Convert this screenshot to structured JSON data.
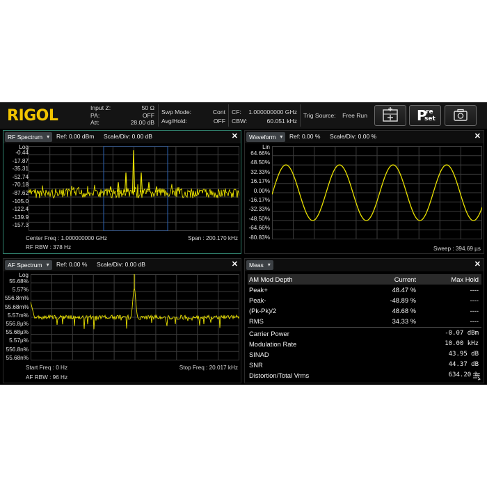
{
  "brand": "RIGOL",
  "header": {
    "input_z_label": "Input Z:",
    "input_z_value": "50 Ω",
    "pa_label": "PA:",
    "pa_value": "OFF",
    "att_label": "Att:",
    "att_value": "28.00 dB",
    "swp_mode_label": "Swp Mode:",
    "swp_mode_value": "Cont",
    "avg_hold_label": "Avg/Hold:",
    "avg_hold_value": "OFF",
    "cf_label": "CF:",
    "cf_value": "1.000000000 GHz",
    "cbw_label": "CBW:",
    "cbw_value": "60.051 kHz",
    "trig_label": "Trig Source:",
    "trig_value": "Free Run",
    "buttons": [
      {
        "name": "add-window-button",
        "icon": "add-window-icon"
      },
      {
        "name": "preset-button",
        "icon": "preset-icon",
        "label_top": "P",
        "label_sub_top": "re",
        "label_sub_bottom": "set"
      },
      {
        "name": "screenshot-button",
        "icon": "camera-icon"
      }
    ]
  },
  "rf": {
    "tab": "RF Spectrum",
    "ref": "Ref: 0.00 dBm",
    "scale": "Scale/Div: 0.00 dB",
    "scale_type": "Log",
    "y_labels": [
      "-0.44",
      "-17.87",
      "-35.31",
      "-52.74",
      "-70.18",
      "-87.62",
      "-105.0",
      "-122.4",
      "-139.9",
      "-157.3"
    ],
    "center_freq": "Center Freq : 1.000000000 GHz",
    "span": "Span : 200.170 kHz",
    "rbw": "RF RBW : 378 Hz"
  },
  "waveform": {
    "tab": "Waveform",
    "ref": "Ref: 0.00 %",
    "scale": "Scale/Div: 0.00 %",
    "scale_type": "Lin",
    "y_labels": [
      "64.66%",
      "48.50%",
      "32.33%",
      "16.17%",
      "0.00%",
      "-16.17%",
      "-32.33%",
      "-48.50%",
      "-64.66%",
      "-80.83%"
    ],
    "sweep": "Sweep : 394.69 µs"
  },
  "af": {
    "tab": "AF Spectrum",
    "ref": "Ref: 0.00 %",
    "scale": "Scale/Div: 0.00 dB",
    "scale_type": "Log",
    "y_labels": [
      "55.68%",
      "5.57%",
      "556.8m%",
      "55.68m%",
      "5.57m%",
      "556.8µ%",
      "55.68µ%",
      "5.57µ%",
      "556.8n%",
      "55.68n%"
    ],
    "start_freq": "Start Freq : 0 Hz",
    "stop_freq": "Stop Freq : 20.017 kHz",
    "rbw": "AF RBW : 96 Hz"
  },
  "meas": {
    "tab": "Meas",
    "col_headers": [
      "AM Mod Depth",
      "Current",
      "Max Hold"
    ],
    "rows": [
      {
        "label": "Peak+",
        "current": "48.47 %",
        "max": "----"
      },
      {
        "label": "Peak-",
        "current": "-48.89 %",
        "max": "----"
      },
      {
        "label": "(Pk-Pk)/2",
        "current": "48.68 %",
        "max": "----"
      },
      {
        "label": "RMS",
        "current": "34.33 %",
        "max": "----"
      }
    ],
    "params": [
      {
        "label": "Carrier Power",
        "value": "-0.07 dBm"
      },
      {
        "label": "Modulation Rate",
        "value": "10.00 kHz"
      },
      {
        "label": "SINAD",
        "value": "43.95 dB"
      },
      {
        "label": "SNR",
        "value": "44.37 dB"
      },
      {
        "label": "Distortion/Total Vrms",
        "value": "634.20 ‰"
      }
    ]
  },
  "close_glyph": "✕",
  "colors": {
    "trace": "#e8e000",
    "grid": "#3b3b3b",
    "active_border": "#2f7d6a",
    "logo": "#f2c500",
    "marker_box": "#2a5fb0"
  }
}
